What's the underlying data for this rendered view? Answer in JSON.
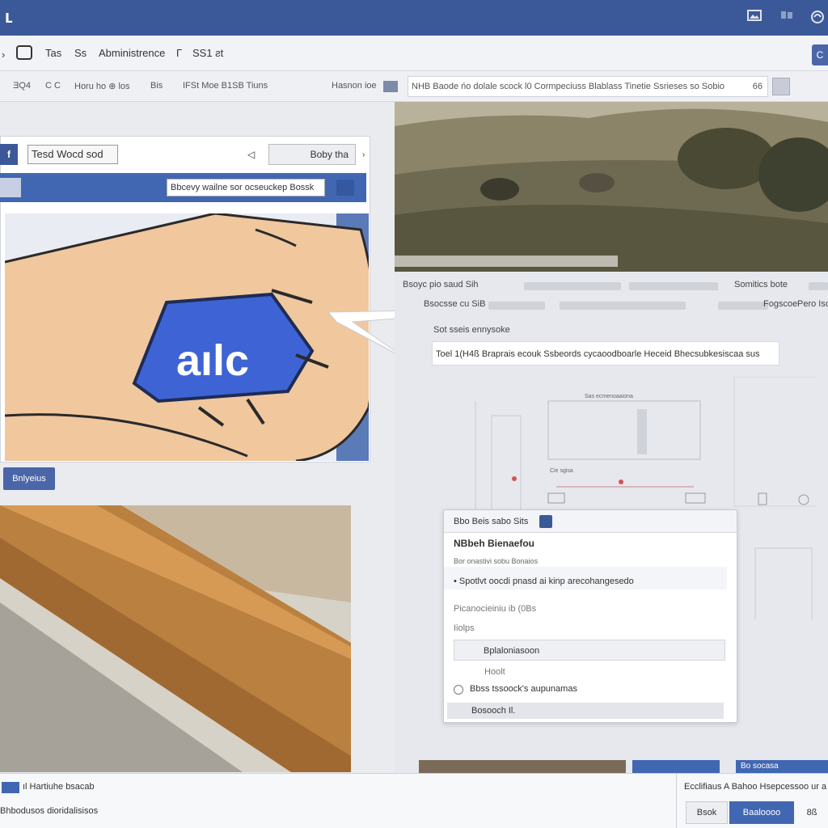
{
  "topbar": {
    "logo": "ʟ",
    "icons": [
      "image-icon",
      "chat-icon",
      "globe-icon"
    ]
  },
  "menubar": {
    "items": [
      "Tas",
      "Ss",
      "Abministrence",
      "Γ",
      "SS1 ƨt"
    ],
    "right_button": "C"
  },
  "toolbar": {
    "items": [
      "ƎQ4",
      "C C",
      "Horu ho ⊕ los",
      "Bis",
      "IFSt Moe B1SB Tiuns",
      "Hasnon ioe"
    ],
    "search_text": "NHB Baode ńo dolale scock  ӏ0 Cormpeciuss Blablass  Tinetie Ssrieses so Sobio",
    "search_count": "66"
  },
  "left": {
    "input_value": "Tesd Wocd sod",
    "button_label": "Boby tha",
    "field_text": "Bbcevy wailne sor ocseuckep Bossk",
    "badge_text": "aılc",
    "blue_button": "Bnlyeius"
  },
  "right": {
    "line1": "Bsoyc pio saud  Sih",
    "line1b": "Somitics bote",
    "line2": "Bsocsse cu SiB",
    "line2b": "Fogscoe",
    "line2c": "Pero Iso",
    "line3": "Sot  sseis ennysoke",
    "field_text": "Toel  1(H4ß Braprais ecouk  Ssbeords cycaoodboarle  Heceid Bhecsubkesiscaa sus",
    "chart_caption": "Sas ecmenoaaiona",
    "chart_label": "Cie sgisa"
  },
  "dialog": {
    "header": "Bbo  Beis sabo Sits",
    "title": "NBbeh Bienaefou",
    "subtitle": "Bor onastivi sobu Bonaios",
    "bullet": "Spotlvt oocdi pnasd ai kinp arecohangesedo",
    "row1": "Picanocieiniu ib (0Bs",
    "row2": "Iiolps",
    "option1": "Bplaloniasoon",
    "row3": "Hoolt",
    "radio_label": "Bbss tssoock's aupunamas",
    "footer": "Bosooch  Il."
  },
  "bottombar": {
    "left_top": "ıl Hartiuhe bsacab",
    "left_bottom": "Bhbodusos dioridalisisos",
    "right_top": "Ecclifiaus  A Bahoo Hsepcessoo ur a",
    "btn1": "Bsok",
    "btn2": "Baaloooo",
    "btn3": "8ß",
    "strip_label": "Bo socasa"
  },
  "colors": {
    "brand": "#3b5998",
    "accent": "#4267b2"
  }
}
